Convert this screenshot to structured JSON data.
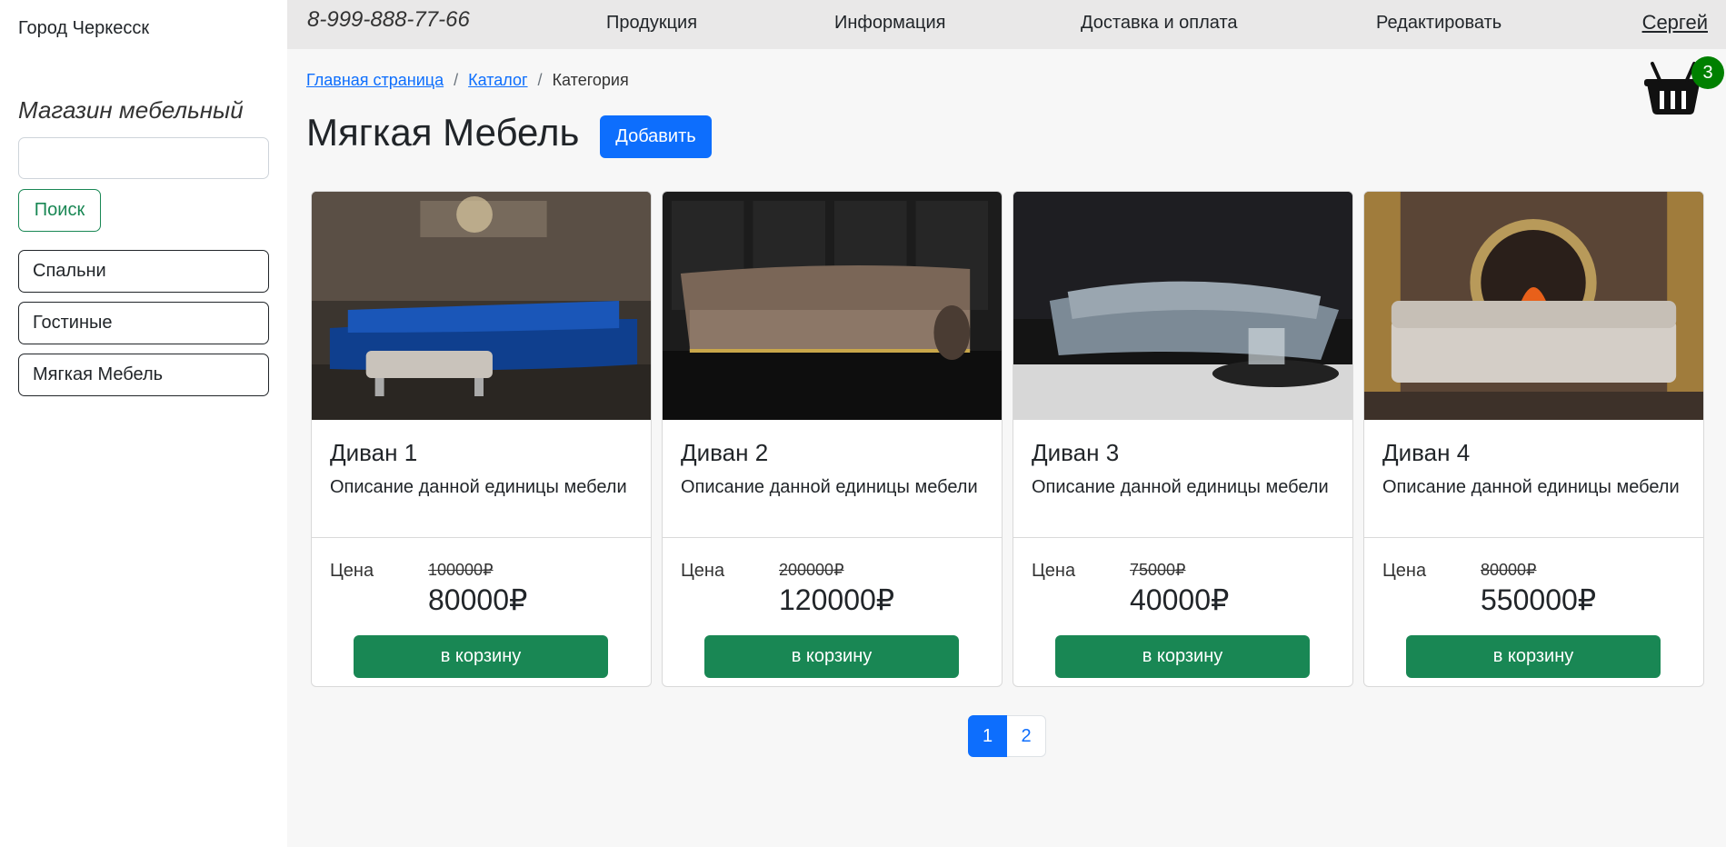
{
  "sidebar": {
    "city": "Город Черкесск",
    "shop_name": "Магазин мебельный",
    "search_value": "",
    "search_button": "Поиск",
    "categories": [
      {
        "label": "Спальни"
      },
      {
        "label": "Гостиные"
      },
      {
        "label": "Мягкая Мебель"
      }
    ]
  },
  "topbar": {
    "phone": "8-999-888-77-66",
    "nav": [
      {
        "label": "Продукция"
      },
      {
        "label": "Информация"
      },
      {
        "label": "Доставка и оплата"
      },
      {
        "label": "Редактировать"
      }
    ],
    "user": "Сергей"
  },
  "breadcrumb": {
    "home": "Главная страница",
    "catalog": "Каталог",
    "current": "Категория"
  },
  "page": {
    "title": "Мягкая Мебель",
    "add_button": "Добавить"
  },
  "cart": {
    "count": "3",
    "icon": "basket-icon"
  },
  "products": [
    {
      "title": "Диван 1",
      "description": "Описание данной единицы мебели",
      "price_label": "Цена",
      "old_price": "100000₽",
      "new_price": "80000₽",
      "button": "в корзину"
    },
    {
      "title": "Диван 2",
      "description": "Описание данной единицы мебели",
      "price_label": "Цена",
      "old_price": "200000₽",
      "new_price": "120000₽",
      "button": "в корзину"
    },
    {
      "title": "Диван 3",
      "description": "Описание данной единицы мебели",
      "price_label": "Цена",
      "old_price": "75000₽",
      "new_price": "40000₽",
      "button": "в корзину"
    },
    {
      "title": "Диван 4",
      "description": "Описание данной единицы мебели",
      "price_label": "Цена",
      "old_price": "80000₽",
      "new_price": "550000₽",
      "button": "в корзину"
    }
  ],
  "pagination": {
    "pages": [
      "1",
      "2"
    ],
    "active": "1"
  },
  "colors": {
    "primary": "#0d6efd",
    "success": "#198754",
    "badge": "#008000"
  }
}
